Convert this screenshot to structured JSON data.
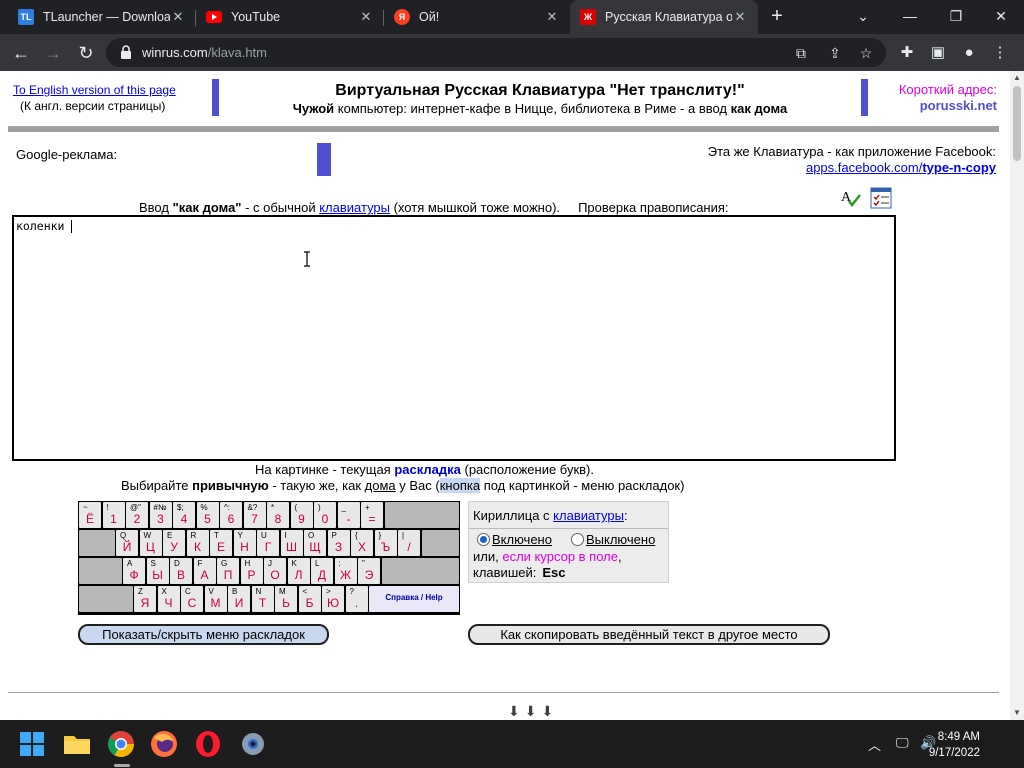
{
  "browser": {
    "tabs": [
      {
        "title": "TLauncher — Downloa",
        "favicon": "TL"
      },
      {
        "title": "YouTube",
        "favicon": "youtube-icon"
      },
      {
        "title": "Ой!",
        "favicon": "Я"
      },
      {
        "title": "Русская Клавиатура о",
        "favicon": "Ж"
      }
    ],
    "new_tab": "+",
    "url_host": "winrus.com",
    "url_path": "/klava.htm",
    "accent": "#202124"
  },
  "header": {
    "english_link": "To English version of this page",
    "english_sub": "(К англ. версии страницы)",
    "title": "Виртуальная Русская Клавиатура \"Нет транслиту!\"",
    "subtitle_bold1": "Чужой",
    "subtitle_mid": " компьютер: интернет-кафе в Ницце, библиотека в Риме - а ввод ",
    "subtitle_bold2": "как дома",
    "short_label": "Короткий адрес:",
    "short_url": "porusski.net"
  },
  "ads": {
    "label": "Google-реклама:",
    "facebook_line": "Эта же Клавиатура - как приложение Facebook:",
    "facebook_link_prefix": "apps.facebook.com/",
    "facebook_link_bold": "type-n-copy"
  },
  "input": {
    "caption_pre": "Ввод ",
    "caption_bold": "\"как дома\"",
    "caption_mid": " - с обычной ",
    "caption_link": "клавиатуры",
    "caption_post": " (хотя мышкой тоже можно).     Проверка правописания:",
    "text": "коленки "
  },
  "layout_info": {
    "line1_pre": "На картинке - текущая ",
    "line1_bold": "раскладка",
    "line1_post": " (расположение букв).",
    "line2_pre": "Выбирайте ",
    "line2_bold": "привычную",
    "line2_mid": " - такую же, как ",
    "line2_u": "дома",
    "line2_mid2": " у Вас (",
    "line2_hl": "кнопка",
    "line2_post": " под картинкой - меню раскладок)"
  },
  "keyboard": {
    "rows": [
      [
        [
          "~",
          "Ё"
        ],
        [
          "!",
          "1"
        ],
        [
          "@\"",
          "2"
        ],
        [
          "#№",
          "3"
        ],
        [
          "$;",
          "4"
        ],
        [
          "%",
          "5"
        ],
        [
          "^:",
          "6"
        ],
        [
          "&?",
          "7"
        ],
        [
          "*",
          "8"
        ],
        [
          "(",
          "9"
        ],
        [
          ")",
          "0"
        ],
        [
          "_",
          "-"
        ],
        [
          "+",
          "="
        ]
      ],
      [
        [
          "Q",
          "Й"
        ],
        [
          "W",
          "Ц"
        ],
        [
          "E",
          "У"
        ],
        [
          "R",
          "К"
        ],
        [
          "T",
          "Е"
        ],
        [
          "Y",
          "Н"
        ],
        [
          "U",
          "Г"
        ],
        [
          "I",
          "Ш"
        ],
        [
          "O",
          "Щ"
        ],
        [
          "P",
          "З"
        ],
        [
          "{",
          "Х"
        ],
        [
          "}",
          "Ъ"
        ],
        [
          "|",
          "/"
        ]
      ],
      [
        [
          "A",
          "Ф"
        ],
        [
          "S",
          "Ы"
        ],
        [
          "D",
          "В"
        ],
        [
          "F",
          "А"
        ],
        [
          "G",
          "П"
        ],
        [
          "H",
          "Р"
        ],
        [
          "J",
          "О"
        ],
        [
          "K",
          "Л"
        ],
        [
          "L",
          "Д"
        ],
        [
          ":",
          "Ж"
        ],
        [
          "\"",
          "Э"
        ]
      ],
      [
        [
          "Z",
          "Я"
        ],
        [
          "X",
          "Ч"
        ],
        [
          "C",
          "С"
        ],
        [
          "V",
          "М"
        ],
        [
          "B",
          "И"
        ],
        [
          "N",
          "Т"
        ],
        [
          "M",
          "Ь"
        ],
        [
          "<",
          "Б"
        ],
        [
          ">",
          "Ю"
        ],
        [
          "?",
          "."
        ]
      ]
    ],
    "help_label": "Справка / Help"
  },
  "cyrillic": {
    "head": "Кириллица с ",
    "head_link": "клавиатуры",
    "head_colon": ":",
    "on_label": "Включено",
    "off_label": "Выключено",
    "line3_pre": "или, ",
    "line3_pink": "если курсор в поле",
    "line3_post": ",",
    "line4_pre": "клавишей:",
    "line4_key": "Esc"
  },
  "buttons": {
    "layouts": "Показать/скрыть меню раскладок",
    "copy": "Как скопировать введённый текст в другое место"
  },
  "taskbar": {
    "time": "8:49 AM",
    "date": "9/17/2022"
  }
}
